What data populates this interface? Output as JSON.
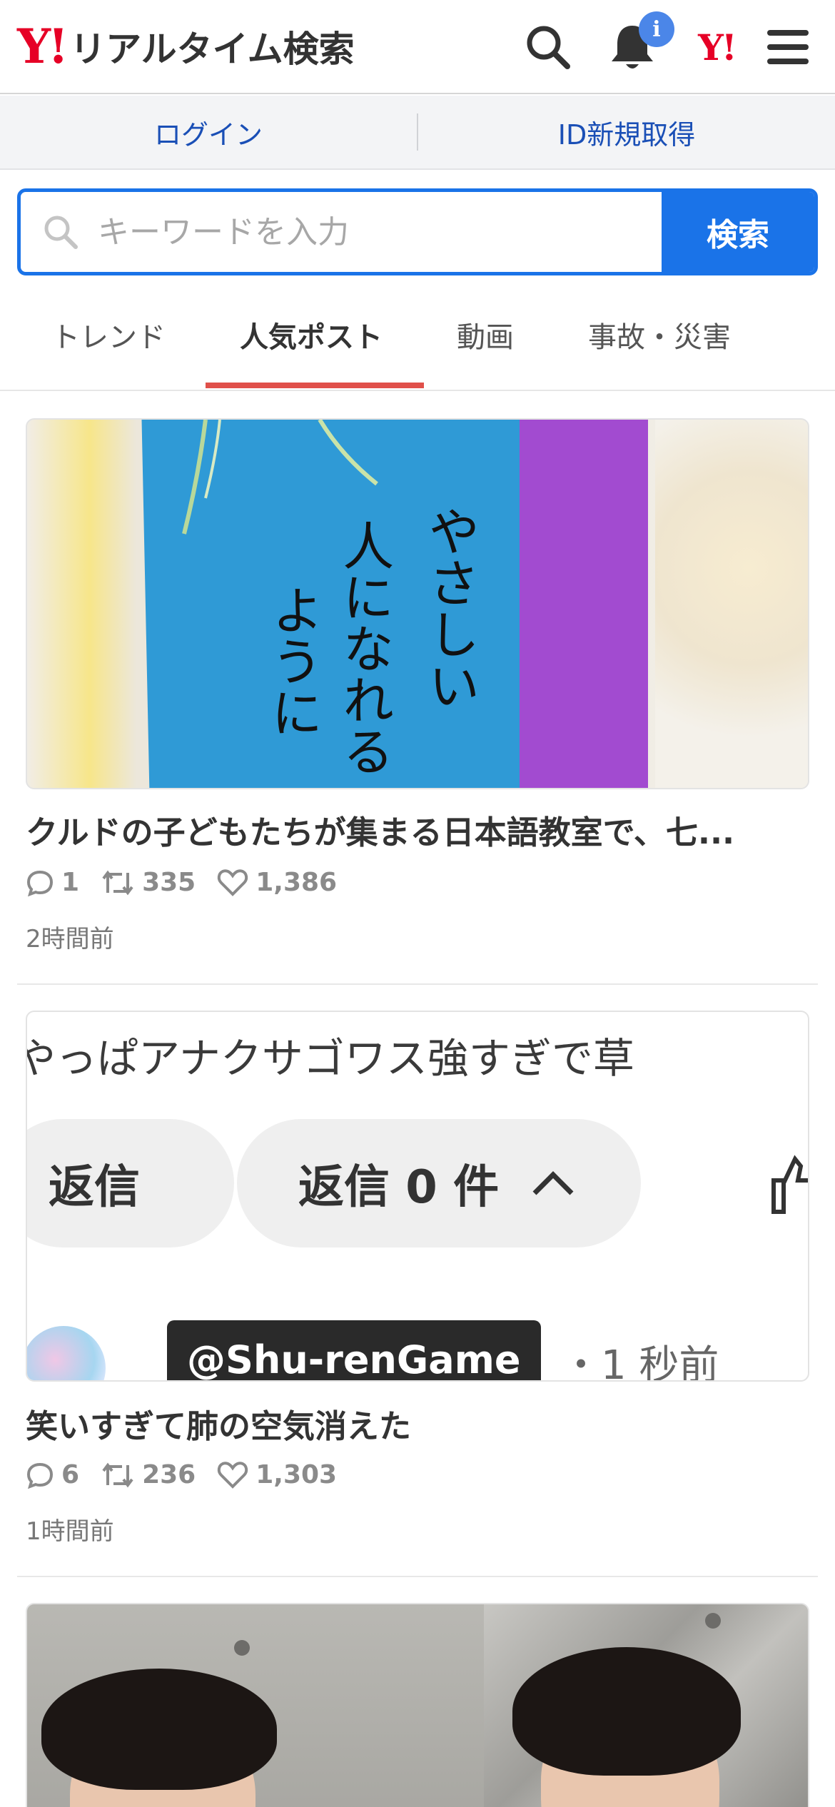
{
  "header": {
    "logo_mark": "Y!",
    "title": "リアルタイム検索",
    "notification_badge": "i",
    "yj_mark": "Y!"
  },
  "auth": {
    "login_label": "ログイン",
    "register_label": "ID新規取得"
  },
  "search": {
    "placeholder": "キーワードを入力",
    "button_label": "検索"
  },
  "tabs": [
    {
      "label": "トレンド",
      "active": false
    },
    {
      "label": "人気ポスト",
      "active": true
    },
    {
      "label": "動画",
      "active": false
    },
    {
      "label": "事故・災害",
      "active": false
    }
  ],
  "posts": [
    {
      "title": "クルドの子どもたちが集まる日本語教室で、七...",
      "replies": "1",
      "reposts": "335",
      "likes": "1,386",
      "time": "2時間前",
      "image_text": [
        "やさしい",
        "人になれる",
        "ように"
      ]
    },
    {
      "title": "笑いすぎて肺の空気消えた",
      "replies": "6",
      "reposts": "236",
      "likes": "1,303",
      "time": "1時間前",
      "image_text": {
        "comment": "やっぱアナクサゴワス強すぎで草",
        "reply_button": "返信",
        "reply_count_button": "返信 0 件",
        "handle": "@Shu-renGame",
        "ago": "・1 秒前"
      }
    }
  ],
  "colors": {
    "accent": "#1a73e8",
    "brand_red": "#e60026",
    "tab_underline": "#e0504a",
    "link": "#1a4fb6",
    "badge": "#4b86e8"
  }
}
